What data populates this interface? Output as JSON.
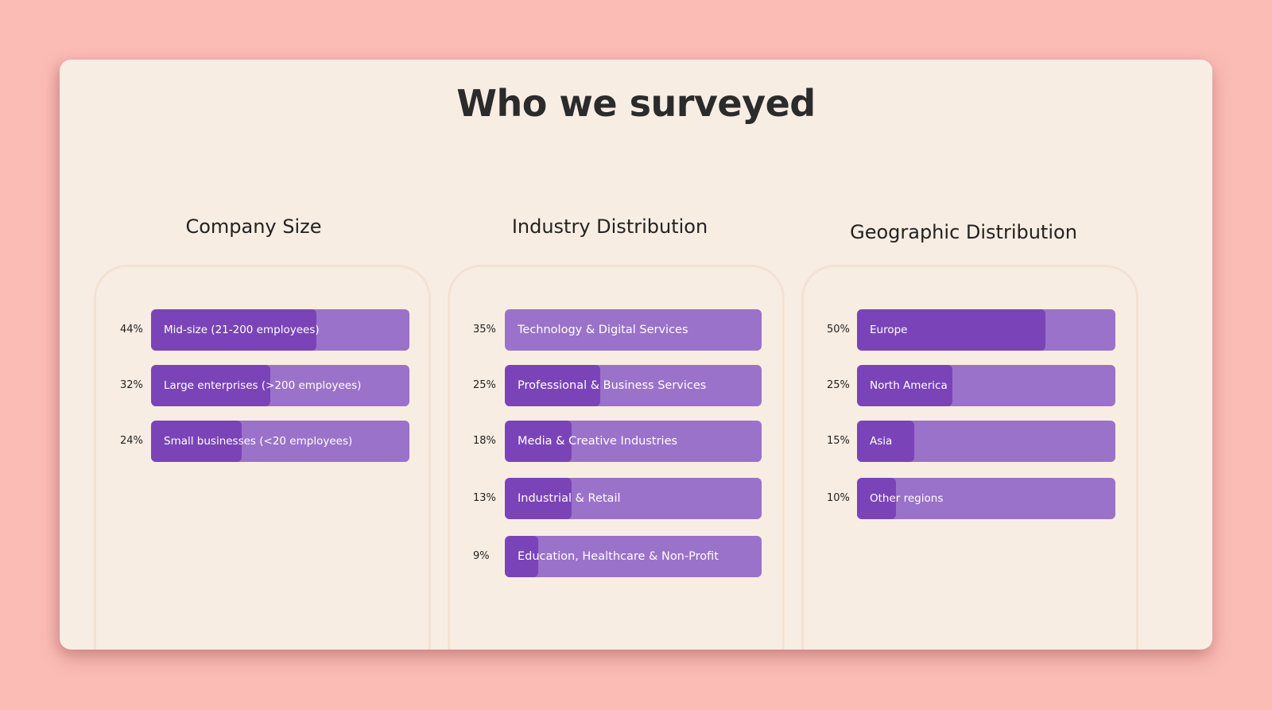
{
  "page": {
    "title": "Who we surveyed",
    "colors": {
      "background": "#fbbcb6",
      "card": "#f8ede3",
      "bar_track": "#9b72c9",
      "bar_fill": "#7a44b8",
      "text": "#222222"
    }
  },
  "chart_data": [
    {
      "type": "bar",
      "orientation": "horizontal",
      "title": "Company Size",
      "categories": [
        "Mid-size (21-200 employees)",
        "Large enterprises (>200 employees)",
        "Small businesses (<20 employees)"
      ],
      "values": [
        44,
        32,
        24
      ],
      "value_labels": [
        "44%",
        "32%",
        "24%"
      ],
      "fill_fraction": [
        0.64,
        0.46,
        0.35
      ],
      "unit": "%"
    },
    {
      "type": "bar",
      "orientation": "horizontal",
      "title": "Industry Distribution",
      "categories": [
        "Technology & Digital Services",
        "Professional & Business Services",
        "Media & Creative Industries",
        "Industrial & Retail",
        "Education, Healthcare & Non-Profit"
      ],
      "values": [
        35,
        25,
        18,
        13,
        9
      ],
      "value_labels": [
        "35%",
        "25%",
        "18%",
        "13%",
        "9%"
      ],
      "fill_fraction": [
        0,
        0.37,
        0.26,
        0.26,
        0.13
      ],
      "unit": "%"
    },
    {
      "type": "bar",
      "orientation": "horizontal",
      "title": "Geographic Distribution",
      "categories": [
        "Europe",
        "North America",
        "Asia",
        "Other regions"
      ],
      "values": [
        50,
        25,
        15,
        10
      ],
      "value_labels": [
        "50%",
        "25%",
        "15%",
        "10%"
      ],
      "fill_fraction": [
        0.73,
        0.37,
        0.22,
        0.15
      ],
      "unit": "%"
    }
  ]
}
